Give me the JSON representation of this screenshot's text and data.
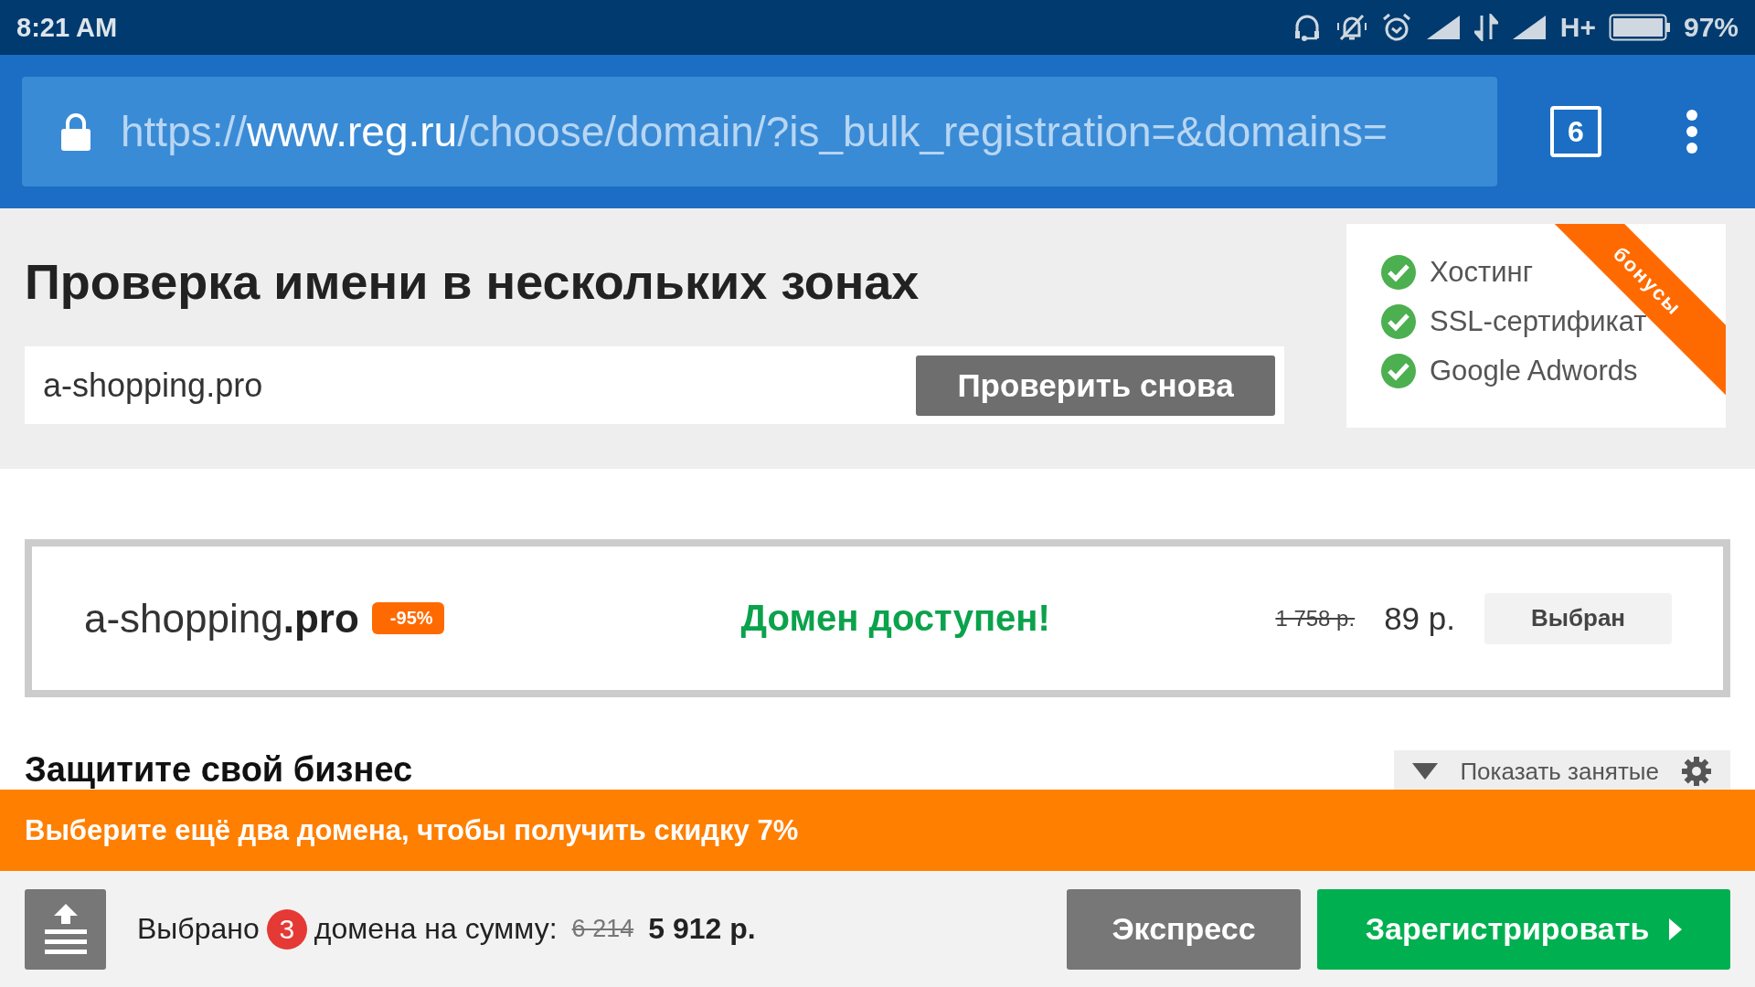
{
  "status_bar": {
    "time": "8:21 AM",
    "network": "H+",
    "battery": "97%"
  },
  "address_bar": {
    "url_parts": [
      {
        "text": "https://",
        "kind": "dim"
      },
      {
        "text": "www.reg.ru",
        "kind": "host"
      },
      {
        "text": "/choose/domain/?is_bulk_registration=&domains=",
        "kind": "dim"
      }
    ],
    "tab_count": "6"
  },
  "search": {
    "title": "Проверка имени в нескольких зонах",
    "value": "a-shopping.pro",
    "button": "Проверить снова"
  },
  "bonuses": {
    "ribbon": "бонусы",
    "items": [
      {
        "label": "Хостинг",
        "checked": true
      },
      {
        "label": "SSL-сертификат",
        "checked": true
      },
      {
        "label": "Google Adwords",
        "checked": true
      }
    ]
  },
  "result": {
    "name": "a-shopping",
    "zone": ".pro",
    "discount": "-95%",
    "status": "Домен доступен!",
    "old_price": "1 758 р.",
    "price": "89 р.",
    "button": "Выбран",
    "selected": true
  },
  "section": {
    "title": "Защитите свой бизнес",
    "filter_button": "Показать занятые"
  },
  "promo": "Выберите ещё два домена, чтобы получить скидку 7%",
  "cart": {
    "label": "Выбрано",
    "count": "3",
    "text": "домена на сумму:",
    "old_total": "6 214",
    "total": "5 912 р.",
    "buttons": [
      {
        "label": "Экспресс",
        "kind": "secondary"
      },
      {
        "label": "Зарегистрировать",
        "kind": "primary"
      }
    ]
  }
}
